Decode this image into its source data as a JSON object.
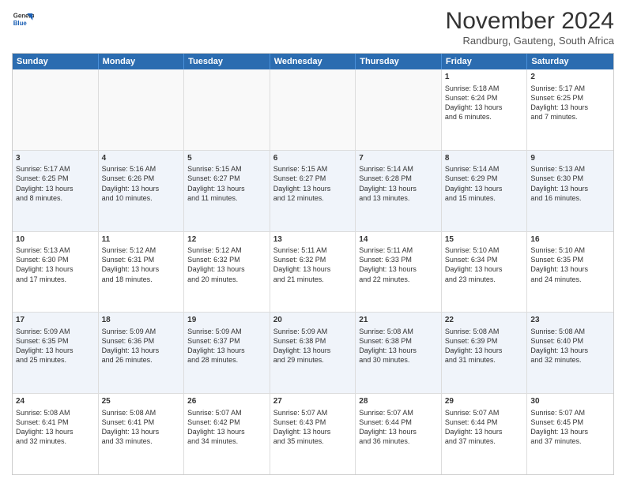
{
  "logo": {
    "line1": "General",
    "line2": "Blue"
  },
  "title": "November 2024",
  "subtitle": "Randburg, Gauteng, South Africa",
  "header_days": [
    "Sunday",
    "Monday",
    "Tuesday",
    "Wednesday",
    "Thursday",
    "Friday",
    "Saturday"
  ],
  "weeks": [
    [
      {
        "day": "",
        "text": "",
        "empty": true
      },
      {
        "day": "",
        "text": "",
        "empty": true
      },
      {
        "day": "",
        "text": "",
        "empty": true
      },
      {
        "day": "",
        "text": "",
        "empty": true
      },
      {
        "day": "",
        "text": "",
        "empty": true
      },
      {
        "day": "1",
        "text": "Sunrise: 5:18 AM\nSunset: 6:24 PM\nDaylight: 13 hours\nand 6 minutes.",
        "empty": false
      },
      {
        "day": "2",
        "text": "Sunrise: 5:17 AM\nSunset: 6:25 PM\nDaylight: 13 hours\nand 7 minutes.",
        "empty": false
      }
    ],
    [
      {
        "day": "3",
        "text": "Sunrise: 5:17 AM\nSunset: 6:25 PM\nDaylight: 13 hours\nand 8 minutes.",
        "empty": false
      },
      {
        "day": "4",
        "text": "Sunrise: 5:16 AM\nSunset: 6:26 PM\nDaylight: 13 hours\nand 10 minutes.",
        "empty": false
      },
      {
        "day": "5",
        "text": "Sunrise: 5:15 AM\nSunset: 6:27 PM\nDaylight: 13 hours\nand 11 minutes.",
        "empty": false
      },
      {
        "day": "6",
        "text": "Sunrise: 5:15 AM\nSunset: 6:27 PM\nDaylight: 13 hours\nand 12 minutes.",
        "empty": false
      },
      {
        "day": "7",
        "text": "Sunrise: 5:14 AM\nSunset: 6:28 PM\nDaylight: 13 hours\nand 13 minutes.",
        "empty": false
      },
      {
        "day": "8",
        "text": "Sunrise: 5:14 AM\nSunset: 6:29 PM\nDaylight: 13 hours\nand 15 minutes.",
        "empty": false
      },
      {
        "day": "9",
        "text": "Sunrise: 5:13 AM\nSunset: 6:30 PM\nDaylight: 13 hours\nand 16 minutes.",
        "empty": false
      }
    ],
    [
      {
        "day": "10",
        "text": "Sunrise: 5:13 AM\nSunset: 6:30 PM\nDaylight: 13 hours\nand 17 minutes.",
        "empty": false
      },
      {
        "day": "11",
        "text": "Sunrise: 5:12 AM\nSunset: 6:31 PM\nDaylight: 13 hours\nand 18 minutes.",
        "empty": false
      },
      {
        "day": "12",
        "text": "Sunrise: 5:12 AM\nSunset: 6:32 PM\nDaylight: 13 hours\nand 20 minutes.",
        "empty": false
      },
      {
        "day": "13",
        "text": "Sunrise: 5:11 AM\nSunset: 6:32 PM\nDaylight: 13 hours\nand 21 minutes.",
        "empty": false
      },
      {
        "day": "14",
        "text": "Sunrise: 5:11 AM\nSunset: 6:33 PM\nDaylight: 13 hours\nand 22 minutes.",
        "empty": false
      },
      {
        "day": "15",
        "text": "Sunrise: 5:10 AM\nSunset: 6:34 PM\nDaylight: 13 hours\nand 23 minutes.",
        "empty": false
      },
      {
        "day": "16",
        "text": "Sunrise: 5:10 AM\nSunset: 6:35 PM\nDaylight: 13 hours\nand 24 minutes.",
        "empty": false
      }
    ],
    [
      {
        "day": "17",
        "text": "Sunrise: 5:09 AM\nSunset: 6:35 PM\nDaylight: 13 hours\nand 25 minutes.",
        "empty": false
      },
      {
        "day": "18",
        "text": "Sunrise: 5:09 AM\nSunset: 6:36 PM\nDaylight: 13 hours\nand 26 minutes.",
        "empty": false
      },
      {
        "day": "19",
        "text": "Sunrise: 5:09 AM\nSunset: 6:37 PM\nDaylight: 13 hours\nand 28 minutes.",
        "empty": false
      },
      {
        "day": "20",
        "text": "Sunrise: 5:09 AM\nSunset: 6:38 PM\nDaylight: 13 hours\nand 29 minutes.",
        "empty": false
      },
      {
        "day": "21",
        "text": "Sunrise: 5:08 AM\nSunset: 6:38 PM\nDaylight: 13 hours\nand 30 minutes.",
        "empty": false
      },
      {
        "day": "22",
        "text": "Sunrise: 5:08 AM\nSunset: 6:39 PM\nDaylight: 13 hours\nand 31 minutes.",
        "empty": false
      },
      {
        "day": "23",
        "text": "Sunrise: 5:08 AM\nSunset: 6:40 PM\nDaylight: 13 hours\nand 32 minutes.",
        "empty": false
      }
    ],
    [
      {
        "day": "24",
        "text": "Sunrise: 5:08 AM\nSunset: 6:41 PM\nDaylight: 13 hours\nand 32 minutes.",
        "empty": false
      },
      {
        "day": "25",
        "text": "Sunrise: 5:08 AM\nSunset: 6:41 PM\nDaylight: 13 hours\nand 33 minutes.",
        "empty": false
      },
      {
        "day": "26",
        "text": "Sunrise: 5:07 AM\nSunset: 6:42 PM\nDaylight: 13 hours\nand 34 minutes.",
        "empty": false
      },
      {
        "day": "27",
        "text": "Sunrise: 5:07 AM\nSunset: 6:43 PM\nDaylight: 13 hours\nand 35 minutes.",
        "empty": false
      },
      {
        "day": "28",
        "text": "Sunrise: 5:07 AM\nSunset: 6:44 PM\nDaylight: 13 hours\nand 36 minutes.",
        "empty": false
      },
      {
        "day": "29",
        "text": "Sunrise: 5:07 AM\nSunset: 6:44 PM\nDaylight: 13 hours\nand 37 minutes.",
        "empty": false
      },
      {
        "day": "30",
        "text": "Sunrise: 5:07 AM\nSunset: 6:45 PM\nDaylight: 13 hours\nand 37 minutes.",
        "empty": false
      }
    ]
  ]
}
